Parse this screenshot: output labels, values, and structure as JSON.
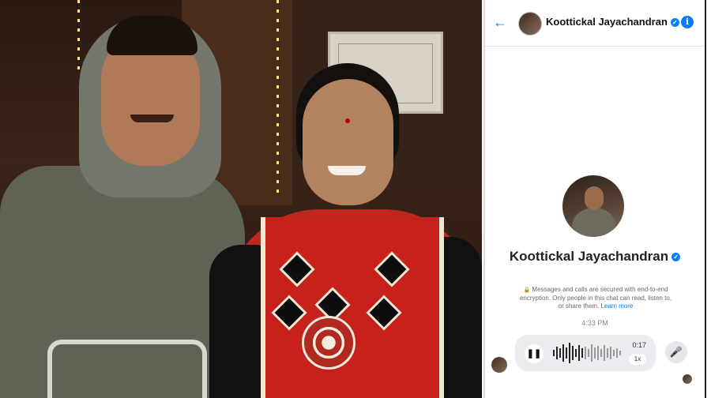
{
  "header": {
    "contact_name": "Koottickal Jayachandran",
    "back_icon": "arrow-left-icon",
    "info_icon": "info-icon"
  },
  "profile": {
    "name": "Koottickal Jayachandran"
  },
  "encryption_notice": {
    "text": "Messages and calls are secured with end-to-end encryption. Only people in this chat can read, listen to, or share them.",
    "link": "Learn more"
  },
  "timestamp": "4:33 PM",
  "voice_message": {
    "duration": "0:17",
    "speed": "1x",
    "control_icon": "pause-icon"
  },
  "composer": {
    "mic_icon": "microphone-icon"
  },
  "colors": {
    "accent": "#0a7cff",
    "bubble": "#ececf0"
  }
}
